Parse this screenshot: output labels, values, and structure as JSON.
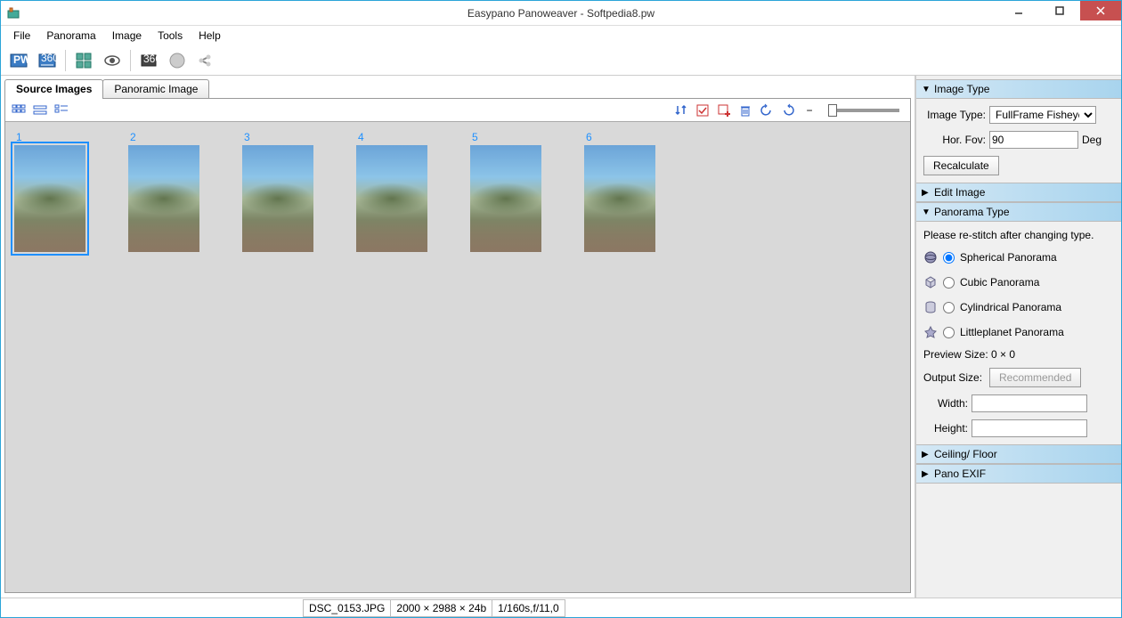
{
  "window": {
    "title": "Easypano Panoweaver - Softpedia8.pw"
  },
  "menu": {
    "file": "File",
    "panorama": "Panorama",
    "image": "Image",
    "tools": "Tools",
    "help": "Help"
  },
  "tabs": {
    "source": "Source Images",
    "panoramic": "Panoramic Image"
  },
  "thumbs": [
    {
      "num": "1"
    },
    {
      "num": "2"
    },
    {
      "num": "3"
    },
    {
      "num": "4"
    },
    {
      "num": "5"
    },
    {
      "num": "6"
    }
  ],
  "right": {
    "imageType": {
      "header": "Image Type",
      "label": "Image Type:",
      "value": "FullFrame Fisheye",
      "fovLabel": "Hor. Fov:",
      "fovValue": "90",
      "fovUnit": "Deg",
      "recalc": "Recalculate"
    },
    "editImage": {
      "header": "Edit Image"
    },
    "panoType": {
      "header": "Panorama Type",
      "note": "Please re-stitch after changing type.",
      "spherical": "Spherical Panorama",
      "cubic": "Cubic Panorama",
      "cylindrical": "Cylindrical Panorama",
      "littleplanet": "Littleplanet Panorama",
      "previewLabel": "Preview Size: 0 × 0",
      "outputLabel": "Output Size:",
      "recommended": "Recommended",
      "widthLabel": "Width:",
      "heightLabel": "Height:"
    },
    "ceiling": {
      "header": "Ceiling/ Floor"
    },
    "exif": {
      "header": "Pano EXIF"
    }
  },
  "status": {
    "filename": "DSC_0153.JPG",
    "dimensions": "2000 × 2988 × 24b",
    "exposure": "1/160s,f/11,0"
  }
}
